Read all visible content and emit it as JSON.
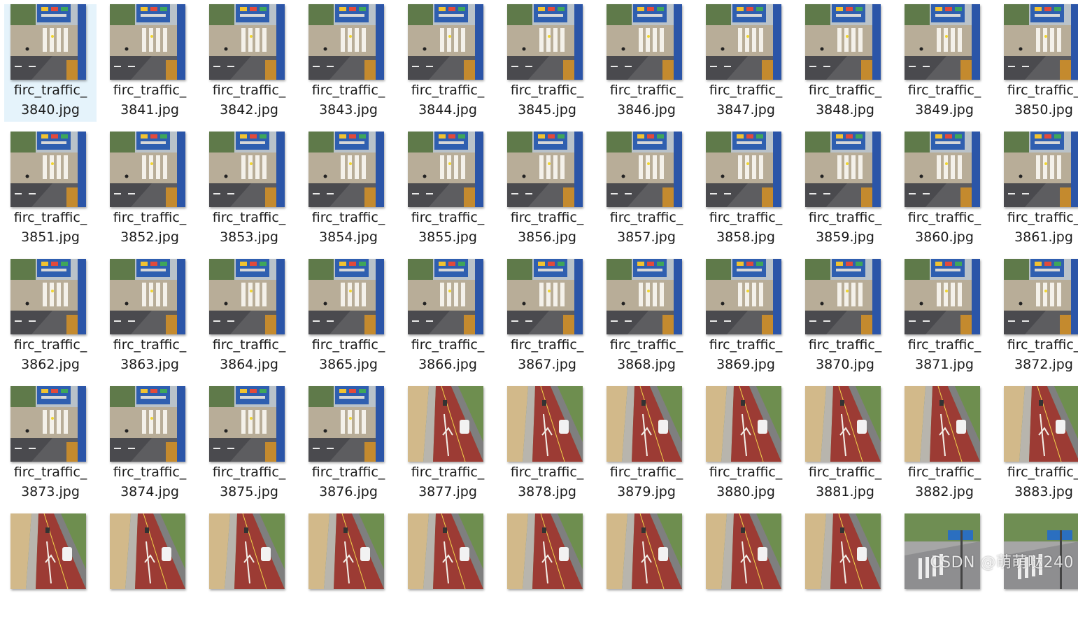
{
  "files": [
    {
      "name": "firc_traffic_\n3840.jpg",
      "scene": "intersection",
      "selected": true
    },
    {
      "name": "firc_traffic_\n3841.jpg",
      "scene": "intersection"
    },
    {
      "name": "firc_traffic_\n3842.jpg",
      "scene": "intersection"
    },
    {
      "name": "firc_traffic_\n3843.jpg",
      "scene": "intersection"
    },
    {
      "name": "firc_traffic_\n3844.jpg",
      "scene": "intersection"
    },
    {
      "name": "firc_traffic_\n3845.jpg",
      "scene": "intersection"
    },
    {
      "name": "firc_traffic_\n3846.jpg",
      "scene": "intersection"
    },
    {
      "name": "firc_traffic_\n3847.jpg",
      "scene": "intersection"
    },
    {
      "name": "firc_traffic_\n3848.jpg",
      "scene": "intersection"
    },
    {
      "name": "firc_traffic_\n3849.jpg",
      "scene": "intersection"
    },
    {
      "name": "firc_traffic_\n3850.jpg",
      "scene": "intersection"
    },
    {
      "name": "firc_traffic_\n3851.jpg",
      "scene": "intersection"
    },
    {
      "name": "firc_traffic_\n3852.jpg",
      "scene": "intersection"
    },
    {
      "name": "firc_traffic_\n3853.jpg",
      "scene": "intersection"
    },
    {
      "name": "firc_traffic_\n3854.jpg",
      "scene": "intersection"
    },
    {
      "name": "firc_traffic_\n3855.jpg",
      "scene": "intersection"
    },
    {
      "name": "firc_traffic_\n3856.jpg",
      "scene": "intersection"
    },
    {
      "name": "firc_traffic_\n3857.jpg",
      "scene": "intersection"
    },
    {
      "name": "firc_traffic_\n3858.jpg",
      "scene": "intersection"
    },
    {
      "name": "firc_traffic_\n3859.jpg",
      "scene": "intersection"
    },
    {
      "name": "firc_traffic_\n3860.jpg",
      "scene": "intersection"
    },
    {
      "name": "firc_traffic_\n3861.jpg",
      "scene": "intersection"
    },
    {
      "name": "firc_traffic_\n3862.jpg",
      "scene": "intersection"
    },
    {
      "name": "firc_traffic_\n3863.jpg",
      "scene": "intersection"
    },
    {
      "name": "firc_traffic_\n3864.jpg",
      "scene": "intersection"
    },
    {
      "name": "firc_traffic_\n3865.jpg",
      "scene": "intersection"
    },
    {
      "name": "firc_traffic_\n3866.jpg",
      "scene": "intersection"
    },
    {
      "name": "firc_traffic_\n3867.jpg",
      "scene": "intersection"
    },
    {
      "name": "firc_traffic_\n3868.jpg",
      "scene": "intersection"
    },
    {
      "name": "firc_traffic_\n3869.jpg",
      "scene": "intersection"
    },
    {
      "name": "firc_traffic_\n3870.jpg",
      "scene": "intersection"
    },
    {
      "name": "firc_traffic_\n3871.jpg",
      "scene": "intersection"
    },
    {
      "name": "firc_traffic_\n3872.jpg",
      "scene": "intersection"
    },
    {
      "name": "firc_traffic_\n3873.jpg",
      "scene": "intersection"
    },
    {
      "name": "firc_traffic_\n3874.jpg",
      "scene": "intersection"
    },
    {
      "name": "firc_traffic_\n3875.jpg",
      "scene": "intersection"
    },
    {
      "name": "firc_traffic_\n3876.jpg",
      "scene": "intersection"
    },
    {
      "name": "firc_traffic_\n3877.jpg",
      "scene": "redroad"
    },
    {
      "name": "firc_traffic_\n3878.jpg",
      "scene": "redroad"
    },
    {
      "name": "firc_traffic_\n3879.jpg",
      "scene": "redroad"
    },
    {
      "name": "firc_traffic_\n3880.jpg",
      "scene": "redroad"
    },
    {
      "name": "firc_traffic_\n3881.jpg",
      "scene": "redroad"
    },
    {
      "name": "firc_traffic_\n3882.jpg",
      "scene": "redroad"
    },
    {
      "name": "firc_traffic_\n3883.jpg",
      "scene": "redroad"
    },
    {
      "name": "",
      "scene": "redroad"
    },
    {
      "name": "",
      "scene": "redroad"
    },
    {
      "name": "",
      "scene": "redroad"
    },
    {
      "name": "",
      "scene": "redroad"
    },
    {
      "name": "",
      "scene": "redroad"
    },
    {
      "name": "",
      "scene": "redroad"
    },
    {
      "name": "",
      "scene": "redroad"
    },
    {
      "name": "",
      "scene": "redroad"
    },
    {
      "name": "",
      "scene": "redroad"
    },
    {
      "name": "",
      "scene": "crossing"
    },
    {
      "name": "",
      "scene": "crossing"
    }
  ],
  "watermark": "CSDN @萌萌哒240",
  "colors": {
    "selection": "#e5f3fb",
    "text": "#1a1a1a",
    "red_lane": "#9c3b34",
    "asphalt": "#6f6f72",
    "building_blue": "#2f5fb0"
  }
}
